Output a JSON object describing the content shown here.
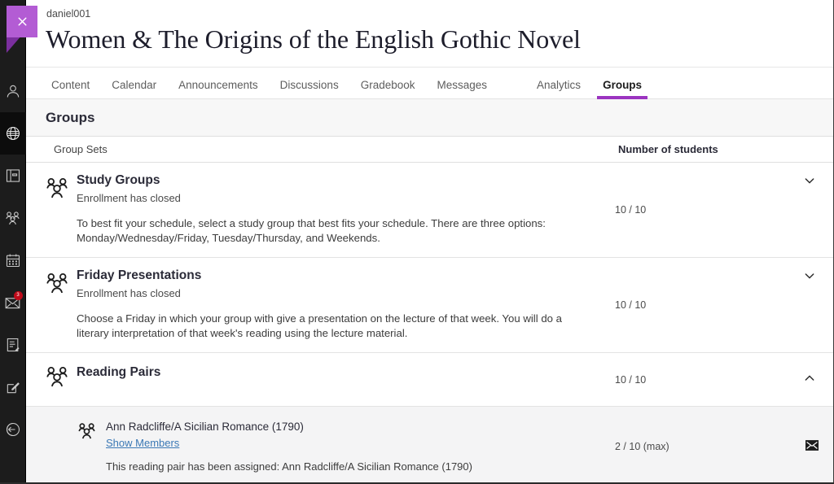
{
  "window": {
    "close_label": "Close"
  },
  "header": {
    "user": "daniel001",
    "course_title": "Women & The Origins of the English Gothic Novel"
  },
  "tabs": [
    {
      "label": "Content",
      "active": false
    },
    {
      "label": "Calendar",
      "active": false
    },
    {
      "label": "Announcements",
      "active": false
    },
    {
      "label": "Discussions",
      "active": false
    },
    {
      "label": "Gradebook",
      "active": false
    },
    {
      "label": "Messages",
      "active": false
    },
    {
      "label": "Analytics",
      "active": false
    },
    {
      "label": "Groups",
      "active": true
    }
  ],
  "section": {
    "title": "Groups"
  },
  "table": {
    "col_group_sets": "Group Sets",
    "col_number_of_students": "Number of students"
  },
  "group_sets": [
    {
      "name": "Study Groups",
      "status": "Enrollment has closed",
      "description": "To best fit your schedule, select a study group that best fits your schedule. There are three options: Monday/Wednesday/Friday, Tuesday/Thursday, and Weekends.",
      "count": "10 / 10",
      "expanded": false,
      "chevron": "chevron-down-icon"
    },
    {
      "name": "Friday Presentations",
      "status": "Enrollment has closed",
      "description": "Choose a Friday in which your group with give a presentation on the lecture of that week. You will do a literary interpretation of that week's reading using the lecture material.",
      "count": "10 / 10",
      "expanded": false,
      "chevron": "chevron-down-icon"
    },
    {
      "name": "Reading Pairs",
      "status": "",
      "description": "",
      "count": "10 / 10",
      "expanded": true,
      "chevron": "chevron-up-icon"
    }
  ],
  "subgroups": [
    {
      "name": "Ann Radcliffe/A Sicilian Romance (1790)",
      "link_label": "Show Members",
      "description": "This reading pair has been assigned: Ann Radcliffe/A Sicilian Romance (1790)",
      "count": "2 / 10 (max)",
      "mail_icon": "envelope-icon"
    }
  ],
  "rail": [
    {
      "icon": "profile-icon",
      "active": false,
      "badge": ""
    },
    {
      "icon": "globe-icon",
      "active": true,
      "badge": ""
    },
    {
      "icon": "courses-icon",
      "active": false,
      "badge": ""
    },
    {
      "icon": "groups-icon",
      "active": false,
      "badge": ""
    },
    {
      "icon": "calendar-icon",
      "active": false,
      "badge": ""
    },
    {
      "icon": "messages-icon",
      "active": false,
      "badge": "3"
    },
    {
      "icon": "grades-icon",
      "active": false,
      "badge": ""
    },
    {
      "icon": "compose-icon",
      "active": false,
      "badge": ""
    },
    {
      "icon": "signout-icon",
      "active": false,
      "badge": ""
    }
  ],
  "colors": {
    "accent_purple": "#9b34c0",
    "close_button": "#b35cd4",
    "close_tail": "#7b2f9e",
    "link_blue": "#3b78b5",
    "badge_red": "#c00a19",
    "rail_background": "#1c1c1c"
  }
}
